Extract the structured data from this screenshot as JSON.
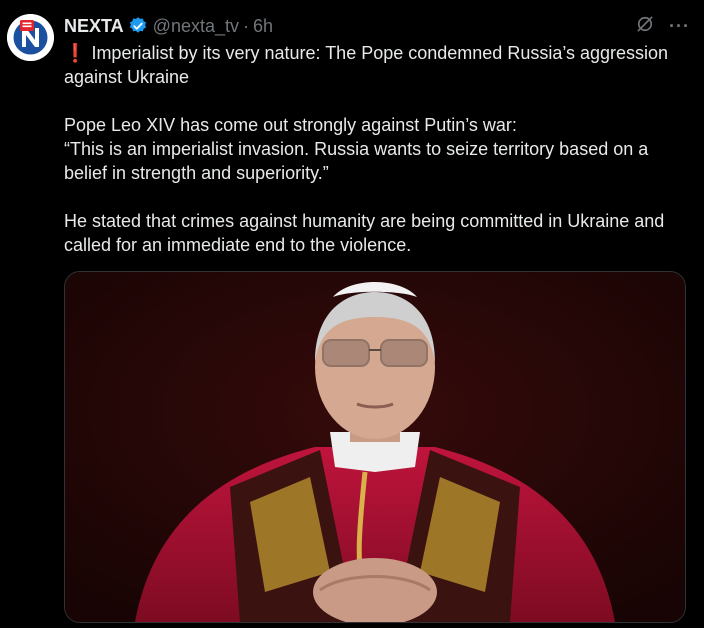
{
  "tweet": {
    "author_name": "NEXTA",
    "handle": "@nexta_tv",
    "separator": "·",
    "time": "6h",
    "more_label": "···",
    "headline_mark": "❗",
    "headline": "Imperialist by its very nature: The Pope condemned Russia’s aggression against Ukraine",
    "paragraph_2": "Pope Leo XIV has come out strongly against Putin’s war:\n“This is an imperialist invasion. Russia wants to seize territory based on a belief in strength and superiority.”",
    "paragraph_3": "He stated that crimes against humanity are being committed in Ukraine and called for an immediate end to the violence."
  },
  "icons": {
    "avatar": "nexta-logo-icon",
    "verified": "verified-badge-icon",
    "grok": "grok-icon",
    "more": "more-options-icon"
  },
  "colors": {
    "background": "#000000",
    "text": "#e7e9ea",
    "muted": "#71767b",
    "verified": "#1d9bf0",
    "brand_red": "#e3262d",
    "brand_blue": "#1b4fa0"
  }
}
